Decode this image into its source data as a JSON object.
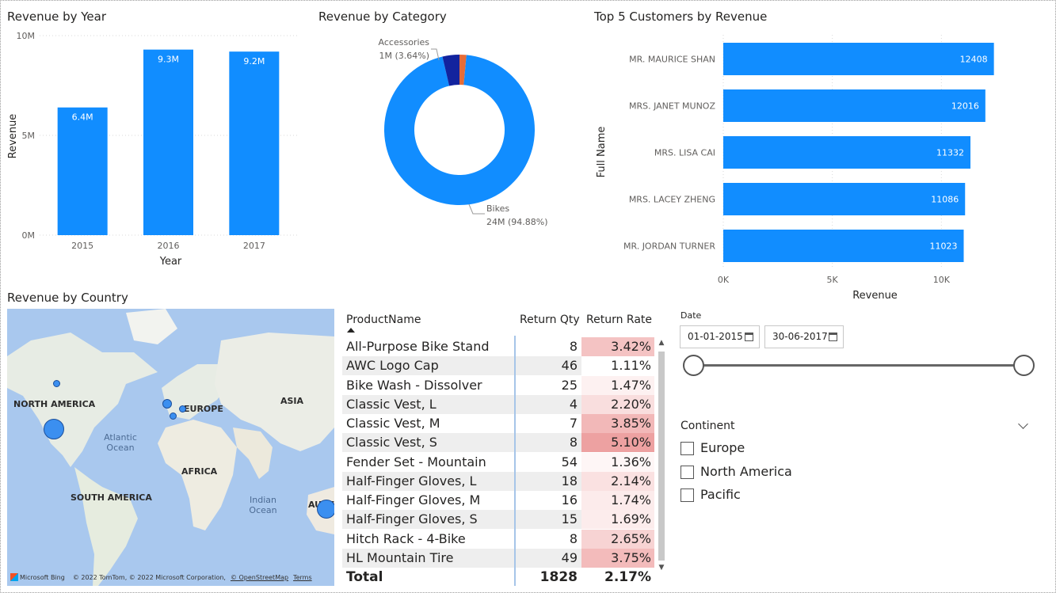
{
  "charts": {
    "revenue_by_year": {
      "title": "Revenue by Year"
    },
    "revenue_by_category": {
      "title": "Revenue by Category"
    },
    "top_customers": {
      "title": "Top 5 Customers by Revenue"
    }
  },
  "chart_data": [
    {
      "type": "bar",
      "title": "Revenue by Year",
      "xlabel": "Year",
      "ylabel": "Revenue",
      "categories": [
        "2015",
        "2016",
        "2017"
      ],
      "values": [
        6.4,
        9.3,
        9.2
      ],
      "data_labels": [
        "6.4M",
        "9.3M",
        "9.2M"
      ],
      "yticks": [
        "0M",
        "5M",
        "10M"
      ],
      "ylim": [
        0,
        10
      ],
      "grid": true,
      "color": "#118DFF"
    },
    {
      "type": "pie",
      "title": "Revenue by Category",
      "slices": [
        {
          "name": "Bikes",
          "value": 24,
          "label_value": "24M (94.88%)",
          "percent": 94.88,
          "color": "#118DFF"
        },
        {
          "name": "Accessories",
          "value": 1,
          "label_value": "1M (3.64%)",
          "percent": 3.64,
          "color": "#12239E"
        },
        {
          "name": "",
          "value": 0.37,
          "percent": 1.48,
          "color": "#E66C37"
        }
      ]
    },
    {
      "type": "bar",
      "orientation": "horizontal",
      "title": "Top 5 Customers by Revenue",
      "xlabel": "Revenue",
      "ylabel": "Full Name",
      "categories": [
        "MR. MAURICE SHAN",
        "MRS. JANET MUNOZ",
        "MRS. LISA CAI",
        "MRS. LACEY ZHENG",
        "MR. JORDAN TURNER"
      ],
      "values": [
        12408,
        12016,
        11332,
        11086,
        11023
      ],
      "xticks": [
        "0K",
        "5K",
        "10K"
      ],
      "xlim": [
        0,
        15000
      ],
      "grid": true,
      "color": "#118DFF"
    }
  ],
  "map": {
    "title": "Revenue by Country",
    "labels": {
      "north_america": "NORTH AMERICA",
      "europe": "EUROPE",
      "asia": "ASIA",
      "africa": "AFRICA",
      "south_america": "SOUTH AMERICA",
      "australia": "AUST"
    },
    "oceans": {
      "atlantic": "Atlantic Ocean",
      "indian": "Indian Ocean"
    },
    "footer": {
      "brand": "Microsoft Bing",
      "copyright": "© 2022 TomTom, © 2022 Microsoft Corporation,",
      "osm": "© OpenStreetMap",
      "terms": "Terms"
    }
  },
  "table": {
    "headers": [
      "ProductName",
      "Return Qty",
      "Return Rate"
    ],
    "rows": [
      {
        "name": "All-Purpose Bike Stand",
        "qty": "8",
        "rate": "3.42%",
        "heat": "#F4C3C3"
      },
      {
        "name": "AWC Logo Cap",
        "qty": "46",
        "rate": "1.11%",
        "heat": "#FFFFFF"
      },
      {
        "name": "Bike Wash - Dissolver",
        "qty": "25",
        "rate": "1.47%",
        "heat": "#FDF1F1"
      },
      {
        "name": "Classic Vest, L",
        "qty": "4",
        "rate": "2.20%",
        "heat": "#F9DEDE"
      },
      {
        "name": "Classic Vest, M",
        "qty": "7",
        "rate": "3.85%",
        "heat": "#F2B8B8"
      },
      {
        "name": "Classic Vest, S",
        "qty": "8",
        "rate": "5.10%",
        "heat": "#EDA1A1"
      },
      {
        "name": "Fender Set - Mountain",
        "qty": "54",
        "rate": "1.36%",
        "heat": "#FEF6F6"
      },
      {
        "name": "Half-Finger Gloves, L",
        "qty": "18",
        "rate": "2.14%",
        "heat": "#FAE1E1"
      },
      {
        "name": "Half-Finger Gloves, M",
        "qty": "16",
        "rate": "1.74%",
        "heat": "#FCEBEB"
      },
      {
        "name": "Half-Finger Gloves, S",
        "qty": "15",
        "rate": "1.69%",
        "heat": "#FCECEC"
      },
      {
        "name": "Hitch Rack - 4-Bike",
        "qty": "8",
        "rate": "2.65%",
        "heat": "#F7D3D3"
      },
      {
        "name": "HL Mountain Tire",
        "qty": "49",
        "rate": "3.75%",
        "heat": "#F3BBBB"
      }
    ],
    "total": {
      "label": "Total",
      "qty": "1828",
      "rate": "2.17%"
    }
  },
  "date_slicer": {
    "title": "Date",
    "start": "01-01-2015",
    "end": "30-06-2017",
    "start_fraction": 0.0,
    "end_fraction": 1.0
  },
  "continent_slicer": {
    "title": "Continent",
    "options": [
      {
        "label": "Europe",
        "checked": false
      },
      {
        "label": "North America",
        "checked": false
      },
      {
        "label": "Pacific",
        "checked": false
      }
    ]
  }
}
